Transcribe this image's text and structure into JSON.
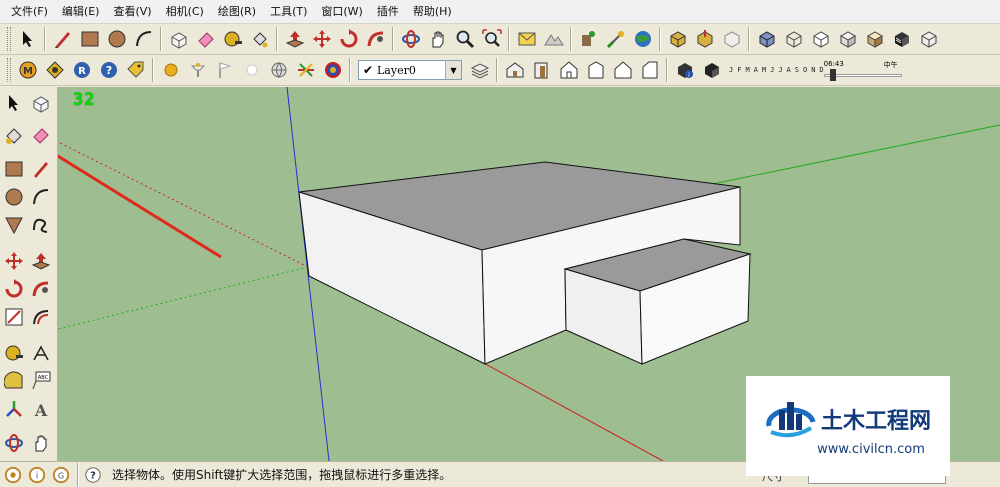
{
  "menu": [
    "文件(F)",
    "编辑(E)",
    "查看(V)",
    "相机(C)",
    "绘图(R)",
    "工具(T)",
    "窗口(W)",
    "插件",
    "帮助(H)"
  ],
  "layers": {
    "current": "Layer0",
    "check": "✔"
  },
  "shadows": {
    "months": [
      "J",
      "F",
      "M",
      "A",
      "M",
      "J",
      "J",
      "A",
      "S",
      "O",
      "N",
      "D"
    ],
    "time": "06:43",
    "noon_label": "中午"
  },
  "viewport": {
    "fps": "32",
    "background": "#9ebd90"
  },
  "status": {
    "message": "选择物体。使用Shift键扩大选择范围，拖拽鼠标进行多重选择。",
    "measure_label": "尺寸"
  },
  "watermark": {
    "title": "土木工程网",
    "url": "www.civilcn.com"
  },
  "colors": {
    "axis_red": "#cc2222",
    "axis_green": "#22aa22",
    "axis_blue": "#2233cc",
    "arrow": "#dd2a1a",
    "brand_blue": "#123a7a"
  },
  "icons": {
    "toolbar1": [
      "select-arrow-icon",
      "pencil-line-icon",
      "rectangle-icon",
      "circle-icon",
      "arc-icon",
      "make-component-icon",
      "eraser-icon",
      "tape-measure-icon",
      "paint-bucket-icon",
      "push-pull-icon",
      "move-icon",
      "rotate-icon",
      "follow-me-icon",
      "orbit-icon",
      "pan-icon",
      "zoom-icon",
      "zoom-extents-icon",
      "previous-view-icon",
      "next-view-icon",
      "add-location-icon",
      "toggle-terrain-icon",
      "google-earth-icon",
      "warehouse-icon",
      "share-model-icon",
      "component-share-icon",
      "xray-icon",
      "wireframe-icon",
      "hidden-line-icon",
      "shaded-icon",
      "textured-icon",
      "monochrome-icon"
    ],
    "toolbar2": [
      "model-info-icon",
      "sandbox-icon",
      "ruby-console-icon",
      "help-icon",
      "tag-icon",
      "sphere-icon",
      "lamp-icon",
      "flag-icon",
      "sun-icon",
      "globe-icon",
      "axes-icon",
      "spiral-icon",
      "layer-manager-icon",
      "iso-view-icon",
      "top-view-icon",
      "front-view-icon",
      "right-view-icon",
      "back-view-icon",
      "left-view-icon",
      "shadow-settings-icon",
      "display-shadows-icon"
    ]
  }
}
